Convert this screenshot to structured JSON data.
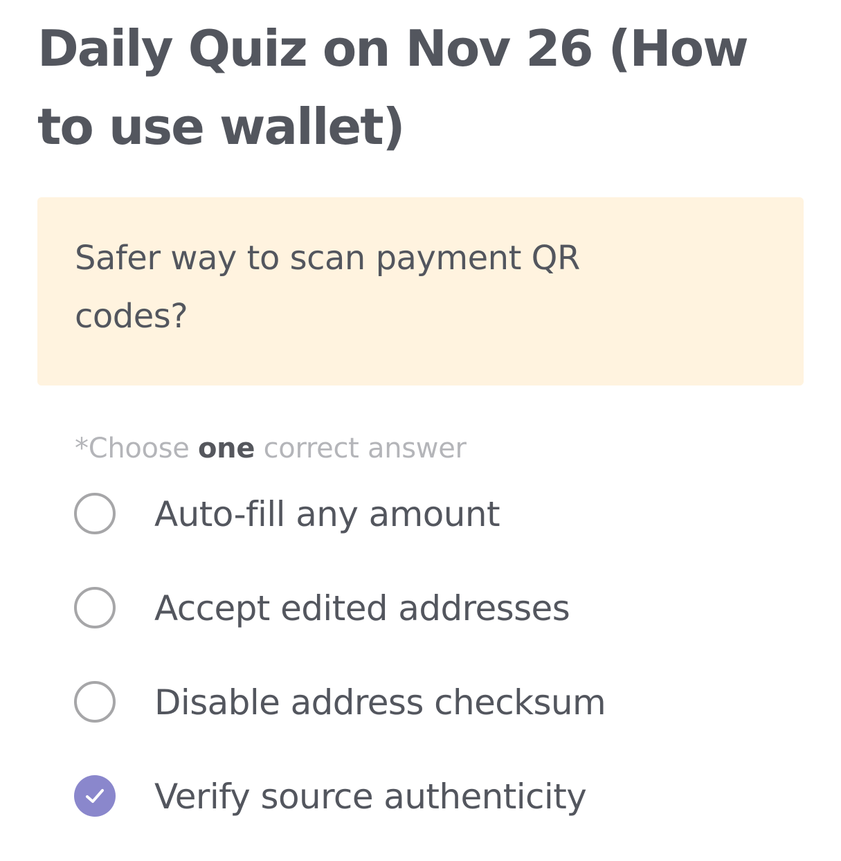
{
  "quiz": {
    "title": "Daily Quiz on Nov 26 (How to use wallet)",
    "question": "Safer way to scan payment QR codes?",
    "instruction": {
      "prefix": "*Choose ",
      "emphasis": "one",
      "suffix": " correct answer"
    },
    "options": [
      {
        "label": "Auto-fill any amount",
        "selected": false
      },
      {
        "label": "Accept edited addresses",
        "selected": false
      },
      {
        "label": "Disable address checksum",
        "selected": false
      },
      {
        "label": "Verify source authenticity",
        "selected": true
      }
    ]
  },
  "colors": {
    "text": "#53565e",
    "question_background": "#fff3df",
    "instruction": "#b4b5b9",
    "radio_border": "#a6a6a8",
    "selected_radio": "#8a87cc"
  },
  "icons": {
    "selected": "check-icon"
  }
}
